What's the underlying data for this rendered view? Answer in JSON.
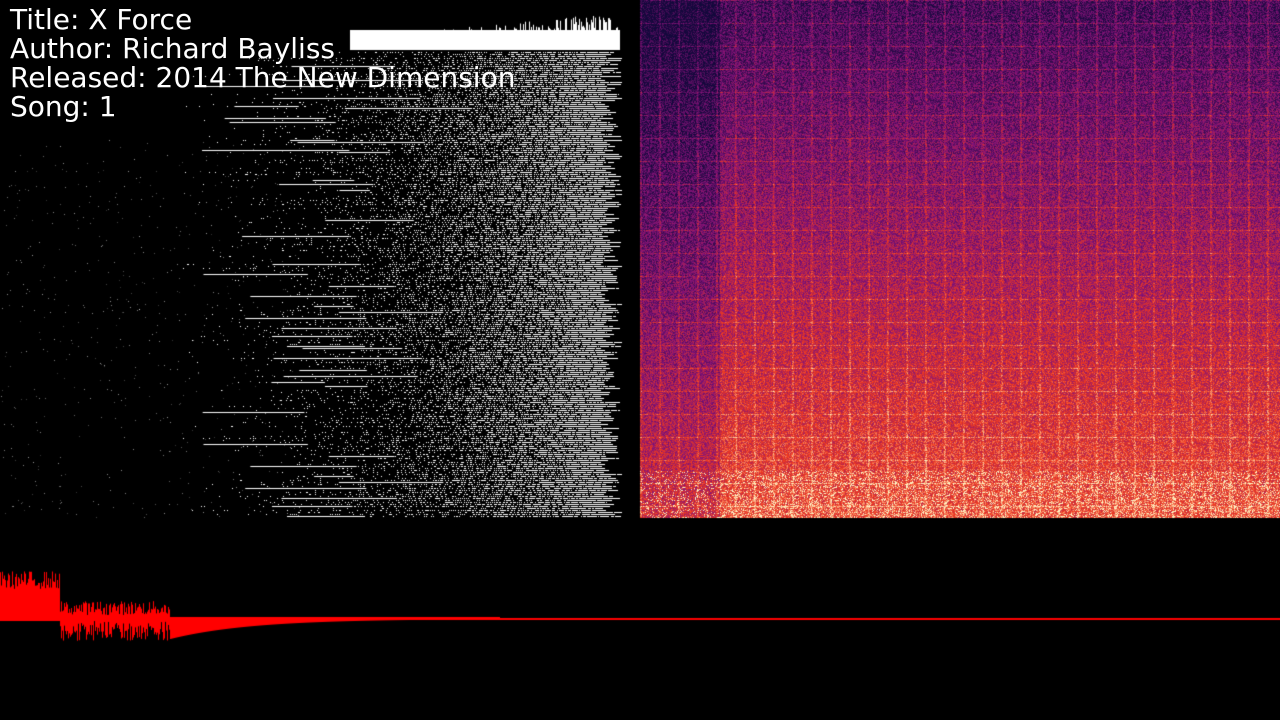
{
  "track_info": {
    "title_line": "Title: X Force",
    "author_line": "Author: Richard Bayliss",
    "released_line": "Released: 2014 The New Dimension",
    "song_line": "Song: 1"
  },
  "colors": {
    "background": "#000000",
    "info_text": "#ffffff",
    "histogram": "#ffffff",
    "waveform": "#ff0000",
    "spectrogram_low": "#1a0a5e",
    "spectrogram_mid": "#c0104a",
    "spectrogram_high": "#ffffc0"
  },
  "panels": [
    "frequency-histogram",
    "spectrogram",
    "waveform"
  ]
}
